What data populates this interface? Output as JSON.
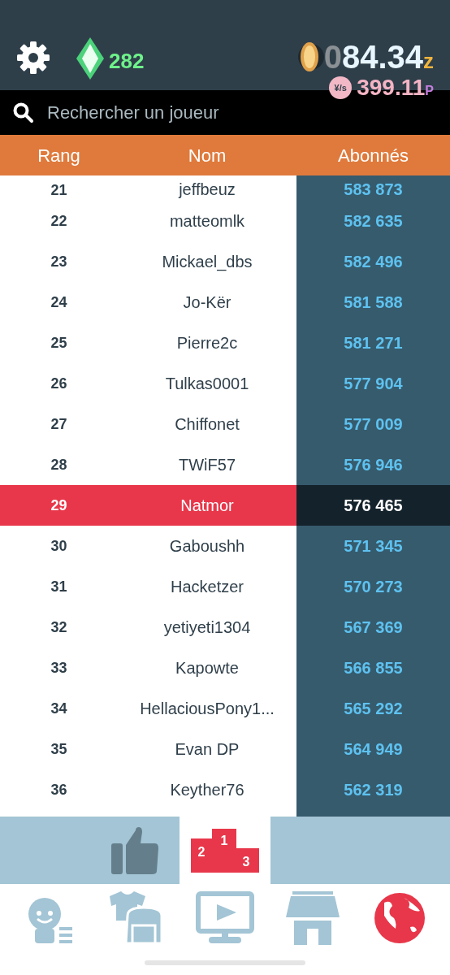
{
  "header": {
    "gems": "282",
    "coins": {
      "dim_prefix": "0",
      "value": "84.34",
      "unit": "z"
    },
    "rate": {
      "icon_label": "¥/s",
      "value": "399.11",
      "unit": "P"
    }
  },
  "search": {
    "placeholder": "Rechercher un joueur"
  },
  "table": {
    "columns": [
      "Rang",
      "Nom",
      "Abonnés"
    ],
    "rows": [
      {
        "rank": "21",
        "name": "jeffbeuz",
        "followers": "583 873",
        "selected": false
      },
      {
        "rank": "22",
        "name": "matteomlk",
        "followers": "582 635",
        "selected": false
      },
      {
        "rank": "23",
        "name": "Mickael_dbs",
        "followers": "582 496",
        "selected": false
      },
      {
        "rank": "24",
        "name": "Jo-Kër",
        "followers": "581 588",
        "selected": false
      },
      {
        "rank": "25",
        "name": "Pierre2c",
        "followers": "581 271",
        "selected": false
      },
      {
        "rank": "26",
        "name": "Tulkas0001",
        "followers": "577 904",
        "selected": false
      },
      {
        "rank": "27",
        "name": "Chiffonet",
        "followers": "577 009",
        "selected": false
      },
      {
        "rank": "28",
        "name": "TWiF57",
        "followers": "576 946",
        "selected": false
      },
      {
        "rank": "29",
        "name": "Natmor",
        "followers": "576 465",
        "selected": true
      },
      {
        "rank": "30",
        "name": "Gaboushh",
        "followers": "571 345",
        "selected": false
      },
      {
        "rank": "31",
        "name": "Hacketzer",
        "followers": "570 273",
        "selected": false
      },
      {
        "rank": "32",
        "name": "yetiyeti1304",
        "followers": "567 369",
        "selected": false
      },
      {
        "rank": "33",
        "name": "Kapowte",
        "followers": "566 855",
        "selected": false
      },
      {
        "rank": "34",
        "name": "HellaciousPony1...",
        "followers": "565 292",
        "selected": false
      },
      {
        "rank": "35",
        "name": "Evan DP",
        "followers": "564 949",
        "selected": false
      },
      {
        "rank": "36",
        "name": "Keyther76",
        "followers": "562 319",
        "selected": false
      }
    ]
  },
  "sub_tabs": [
    {
      "kind": "likes",
      "selected": false
    },
    {
      "kind": "podium",
      "selected": true,
      "labels": [
        "2",
        "1",
        "3"
      ]
    },
    {
      "kind": "empty",
      "selected": false
    }
  ],
  "nav": [
    {
      "kind": "profile",
      "selected": false
    },
    {
      "kind": "wardrobe",
      "selected": false
    },
    {
      "kind": "video",
      "selected": false
    },
    {
      "kind": "shop",
      "selected": false
    },
    {
      "kind": "globe",
      "selected": true
    }
  ]
}
